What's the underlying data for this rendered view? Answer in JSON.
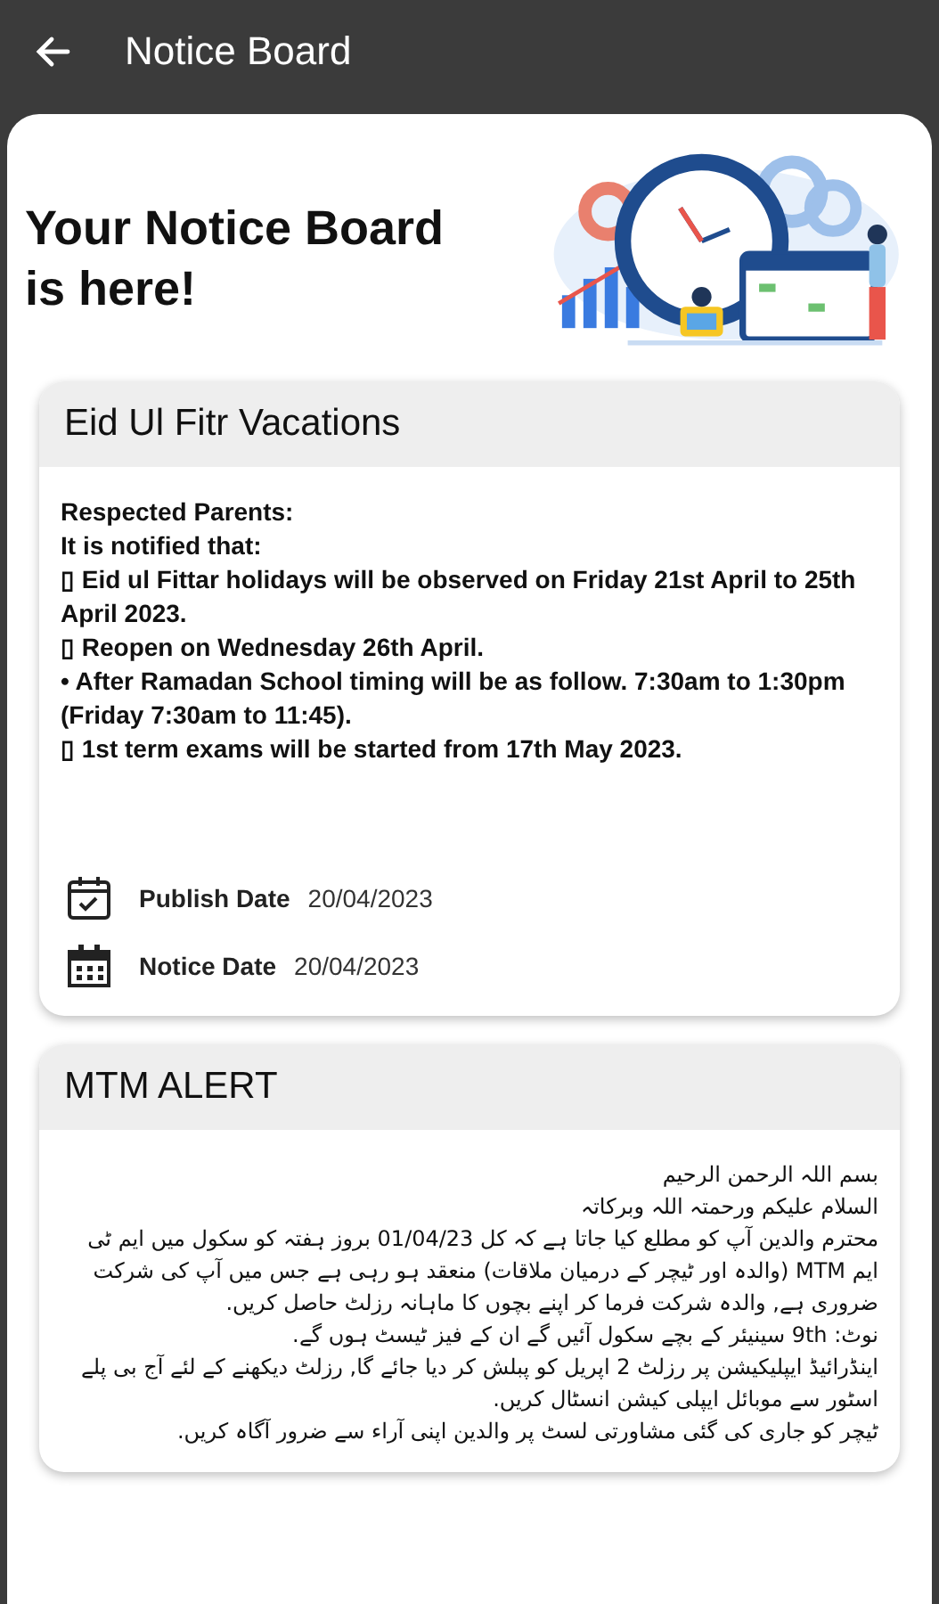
{
  "app_bar": {
    "title": "Notice Board"
  },
  "hero": {
    "title": "Your Notice Board is here!"
  },
  "notices": [
    {
      "title": "Eid Ul Fitr Vacations",
      "kind": "english",
      "lines": [
        "Respected Parents:",
        "It is notified that:",
        "▯ Eid ul Fittar holidays will be observed on Friday 21st April to 25th April 2023.",
        "▯ Reopen on Wednesday 26th April.",
        "• After Ramadan School timing will be as follow. 7:30am to 1:30pm (Friday 7:30am to 11:45).",
        "▯ 1st term exams will be started from 17th May 2023."
      ],
      "dates": [
        {
          "kind": "publish",
          "label": "Publish Date",
          "value": "20/04/2023"
        },
        {
          "kind": "notice",
          "label": "Notice Date",
          "value": "20/04/2023"
        }
      ]
    },
    {
      "title": "MTM ALERT",
      "kind": "urdu",
      "lines": [
        "بسم اللہ الرحمن الرحیم",
        "السلام علیکم ورحمتہ اللہ وبرکاتہ",
        "محترم والدین آپ کو مطلع کیا جاتا ہے کہ کل 01/04/23 بروز ہفتہ کو سکول میں ایم ٹی ایم MTM (والدہ اور ٹیچر کے درمیان ملاقات) منعقد ہو رہی ہے جس میں آپ کی شرکت ضروری ہے, والدہ شرکت فرما کر اپنے بچوں کا ماہانہ رزلٹ حاصل کریں.",
        "نوٹ: 9th سینیئر کے بچے سکول آئیں گے ان کے فیز ٹیسٹ ہوں گے.",
        "اینڈرائیڈ ایپلیکیشن پر رزلٹ 2 اپریل کو پبلش کر دیا جائے گا, رزلٹ دیکھنے کے لئے آج بی پلے اسٹور سے موبائل ایپلی کیشن انسٹال کریں.",
        "ٹیچر کو جاری کی گئی مشاورتی لسٹ پر والدین اپنی آراء سے ضرور آگاہ کریں."
      ]
    }
  ]
}
